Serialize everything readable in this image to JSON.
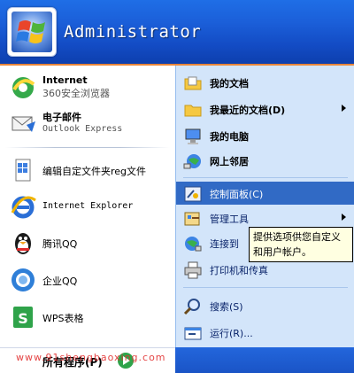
{
  "header": {
    "username": "Administrator"
  },
  "left": {
    "pinned": [
      {
        "title": "Internet",
        "subtitle": "360安全浏览器"
      },
      {
        "title": "电子邮件",
        "subtitle": "Outlook Express"
      }
    ],
    "recent": [
      {
        "label": "编辑自定文件夹reg文件"
      },
      {
        "label": "Internet Explorer"
      },
      {
        "label": "腾讯QQ"
      },
      {
        "label": "企业QQ"
      },
      {
        "label": "WPS表格"
      }
    ],
    "all_programs": "所有程序(P)",
    "watermark": "www.91shengbaoxing.com"
  },
  "right": {
    "items": [
      {
        "label": "我的文档"
      },
      {
        "label": "我最近的文档(D)"
      },
      {
        "label": "我的电脑"
      },
      {
        "label": "网上邻居"
      },
      {
        "label": "控制面板(C)"
      },
      {
        "label": "管理工具"
      },
      {
        "label": "连接到"
      },
      {
        "label": "打印机和传真"
      },
      {
        "label": "搜索(S)"
      },
      {
        "label": "运行(R)..."
      }
    ]
  },
  "tooltip": {
    "line1": "提供选项供您自定义",
    "line2": "和用户帐户。"
  },
  "colors": {
    "header": "#1b5fd9",
    "right_panel": "#d3e5fa",
    "selection": "#316ac5",
    "tooltip_bg": "#ffffe1"
  }
}
